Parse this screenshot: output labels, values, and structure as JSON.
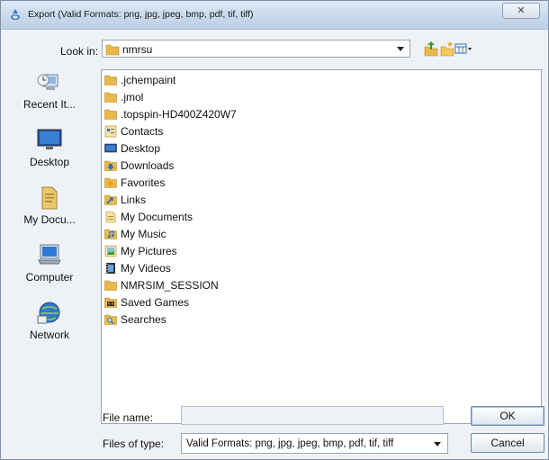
{
  "window": {
    "title": "Export (Valid Formats: png, jpg, jpeg, bmp, pdf, tif, tiff)",
    "close_label": "✕"
  },
  "lookin": {
    "label": "Look in:",
    "value": "nmrsu"
  },
  "places": [
    {
      "label": "Recent It...",
      "icon": "recent-items-icon"
    },
    {
      "label": "Desktop",
      "icon": "desktop-icon"
    },
    {
      "label": "My Docu...",
      "icon": "my-documents-icon"
    },
    {
      "label": "Computer",
      "icon": "computer-icon"
    },
    {
      "label": "Network",
      "icon": "network-icon"
    }
  ],
  "files": [
    {
      "name": ".jchempaint",
      "icon": "folder-icon"
    },
    {
      "name": ".jmol",
      "icon": "folder-icon"
    },
    {
      "name": ".topspin-HD400Z420W7",
      "icon": "folder-icon"
    },
    {
      "name": "Contacts",
      "icon": "contacts-folder-icon"
    },
    {
      "name": "Desktop",
      "icon": "desktop-folder-icon"
    },
    {
      "name": "Downloads",
      "icon": "downloads-folder-icon"
    },
    {
      "name": "Favorites",
      "icon": "favorites-folder-icon"
    },
    {
      "name": "Links",
      "icon": "links-folder-icon"
    },
    {
      "name": "My Documents",
      "icon": "documents-folder-icon"
    },
    {
      "name": "My Music",
      "icon": "music-folder-icon"
    },
    {
      "name": "My Pictures",
      "icon": "pictures-folder-icon"
    },
    {
      "name": "My Videos",
      "icon": "videos-folder-icon"
    },
    {
      "name": "NMRSIM_SESSION",
      "icon": "folder-icon"
    },
    {
      "name": "Saved Games",
      "icon": "saved-games-folder-icon"
    },
    {
      "name": "Searches",
      "icon": "searches-folder-icon"
    }
  ],
  "bottom": {
    "file_name_label": "File name:",
    "file_name_value": "",
    "files_of_type_label": "Files of type:",
    "files_of_type_value": "Valid Formats: png, jpg, jpeg, bmp, pdf, tif, tiff",
    "ok_label": "OK",
    "cancel_label": "Cancel"
  },
  "colors": {
    "folder": "#e8b84a",
    "accent": "#2f6fb5"
  }
}
